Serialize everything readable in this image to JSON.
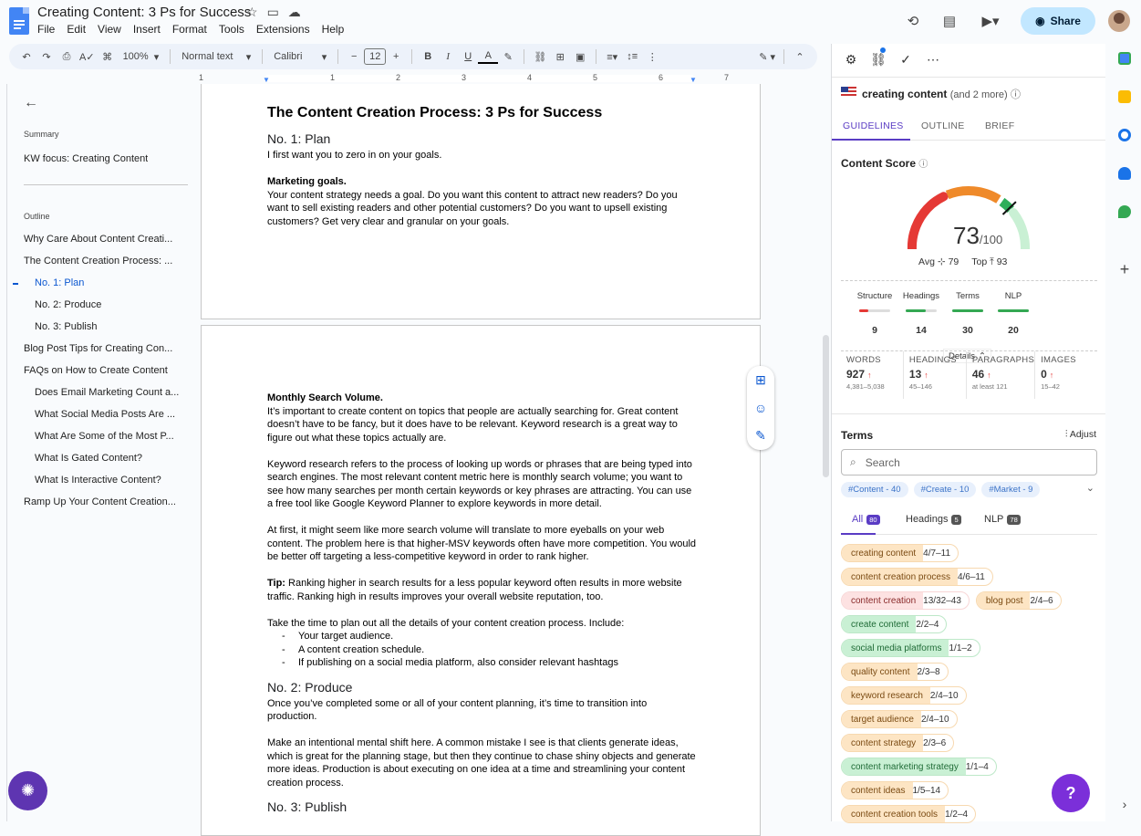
{
  "doc": {
    "title": "Creating Content: 3 Ps for Success",
    "menu": [
      "File",
      "Edit",
      "View",
      "Insert",
      "Format",
      "Tools",
      "Extensions",
      "Help"
    ],
    "share_label": "Share"
  },
  "toolbar": {
    "zoom": "100%",
    "style": "Normal text",
    "font": "Calibri",
    "font_size": "12"
  },
  "ruler": {
    "numbers": [
      "1",
      "1",
      "2",
      "3",
      "4",
      "5",
      "6",
      "7"
    ]
  },
  "outline_panel": {
    "summary_label": "Summary",
    "summary_text": "KW focus: Creating Content",
    "outline_label": "Outline",
    "items": [
      {
        "text": "Why Care About Content Creati...",
        "level": 1
      },
      {
        "text": "The Content Creation Process: ...",
        "level": 1
      },
      {
        "text": "No. 1: Plan",
        "level": 2,
        "active": true
      },
      {
        "text": "No. 2: Produce",
        "level": 2
      },
      {
        "text": "No. 3: Publish",
        "level": 2
      },
      {
        "text": "Blog Post Tips for Creating Con...",
        "level": 1
      },
      {
        "text": "FAQs on How to Create Content",
        "level": 1
      },
      {
        "text": "Does Email Marketing Count a...",
        "level": 2
      },
      {
        "text": "What Social Media Posts Are ...",
        "level": 2
      },
      {
        "text": "What Are Some of the Most P...",
        "level": 2
      },
      {
        "text": "What Is Gated Content?",
        "level": 2
      },
      {
        "text": "What Is Interactive Content?",
        "level": 2
      },
      {
        "text": "Ramp Up Your Content Creation...",
        "level": 1
      }
    ]
  },
  "page1": {
    "h1": "The Content Creation Process: 3 Ps for Success",
    "h2": "No. 1: Plan",
    "p1": "I first want you to zero in on your goals.",
    "bold1": "Marketing goals.",
    "p2": "Your content strategy needs a goal. Do you want this content to attract new readers? Do you want to sell existing readers and other potential customers? Do you want to upsell existing customers? Get very clear and granular on your goals."
  },
  "page2": {
    "bold1": "Monthly Search Volume.",
    "p1": "It’s important to create content on topics that people are actually searching for. Great content doesn’t have to be fancy, but it does have to be relevant. Keyword research is a great way to figure out what these topics actually are.",
    "p2": "Keyword research refers to the process of looking up words or phrases that are being typed into search engines. The most relevant content metric here is monthly search volume; you want to see how many searches per month certain keywords or key phrases are attracting. You can use a free tool like Google Keyword Planner to explore keywords in more detail.",
    "p3": "At first, it might seem like more search volume will translate to more eyeballs on your web content. The problem here is that higher-MSV keywords often have more competition. You would be better off targeting a less-competitive keyword in order to rank higher.",
    "tip_label": "Tip:",
    "tip": " Ranking higher in search results for a less popular keyword often results in more website traffic. Ranking high in results improves your overall website reputation, too.",
    "p4": "Take the time to plan out all the details of your content creation process. Include:",
    "list": [
      "Your target audience.",
      "A content creation schedule.",
      "If publishing on a social media platform, also consider relevant hashtags"
    ],
    "h2b": "No. 2: Produce",
    "p5": "Once you’ve completed some or all of your content planning, it’s time to transition into production.",
    "p6": "Make an intentional mental shift here. A common mistake I see is that clients generate ideas, which is great for the planning stage, but then they continue to chase shiny objects and generate more ideas. Production is about executing on one idea at a time and streamlining your content creation process.",
    "h2c": "No. 3: Publish"
  },
  "panel": {
    "keyword": "creating content",
    "keyword_more": "(and 2 more)",
    "tabs": [
      "GUIDELINES",
      "OUTLINE",
      "BRIEF"
    ],
    "content_score_label": "Content Score",
    "score": "73",
    "score_max": "/100",
    "score_value": 73,
    "avg_label": "Avg",
    "avg": "79",
    "top_label": "Top",
    "top": "93",
    "metrics": [
      {
        "label": "Structure",
        "value": "9",
        "fill": 0.3,
        "color": "#e53935"
      },
      {
        "label": "Headings",
        "value": "14",
        "fill": 0.65,
        "color": "#34a853"
      },
      {
        "label": "Terms",
        "value": "30",
        "fill": 1.0,
        "color": "#34a853"
      },
      {
        "label": "NLP",
        "value": "20",
        "fill": 1.0,
        "color": "#34a853"
      }
    ],
    "details_label": "Details",
    "stats": [
      {
        "label": "WORDS",
        "value": "927",
        "range": "4,381–5,038"
      },
      {
        "label": "HEADINGS",
        "value": "13",
        "range": "45–146"
      },
      {
        "label": "PARAGRAPHS",
        "value": "46",
        "range": "at least 121"
      },
      {
        "label": "IMAGES",
        "value": "0",
        "range": "15–42"
      }
    ],
    "terms_label": "Terms",
    "adjust_label": "Adjust",
    "search_placeholder": "Search",
    "hashtags": [
      "#Content - 40",
      "#Create - 10",
      "#Market - 9"
    ],
    "sub_tabs": [
      {
        "label": "All",
        "count": "80"
      },
      {
        "label": "Headings",
        "count": "5"
      },
      {
        "label": "NLP",
        "count": "78"
      }
    ],
    "chips": [
      [
        {
          "text": "creating content",
          "count": "4/7–11",
          "kind": "y"
        }
      ],
      [
        {
          "text": "content creation process",
          "count": "4/6–11",
          "kind": "y"
        }
      ],
      [
        {
          "text": "content creation",
          "count": "13/32–43",
          "kind": "r"
        },
        {
          "text": "blog post",
          "count": "2/4–6",
          "kind": "y"
        }
      ],
      [
        {
          "text": "create content",
          "count": "2/2–4",
          "kind": "g"
        }
      ],
      [
        {
          "text": "social media platforms",
          "count": "1/1–2",
          "kind": "g"
        }
      ],
      [
        {
          "text": "quality content",
          "count": "2/3–8",
          "kind": "y"
        }
      ],
      [
        {
          "text": "keyword research",
          "count": "2/4–10",
          "kind": "y"
        }
      ],
      [
        {
          "text": "target audience",
          "count": "2/4–10",
          "kind": "y"
        }
      ],
      [
        {
          "text": "content strategy",
          "count": "2/3–6",
          "kind": "y"
        }
      ],
      [
        {
          "text": "content marketing strategy",
          "count": "1/1–4",
          "kind": "g"
        }
      ],
      [
        {
          "text": "content ideas",
          "count": "1/5–14",
          "kind": "y"
        }
      ],
      [
        {
          "text": "content creation tools",
          "count": "1/2–4",
          "kind": "y"
        }
      ]
    ],
    "help": "?"
  },
  "colors": {
    "accent": "#5a3cc4",
    "share_bg": "#c2e7ff",
    "link_blue": "#0b57d0"
  }
}
